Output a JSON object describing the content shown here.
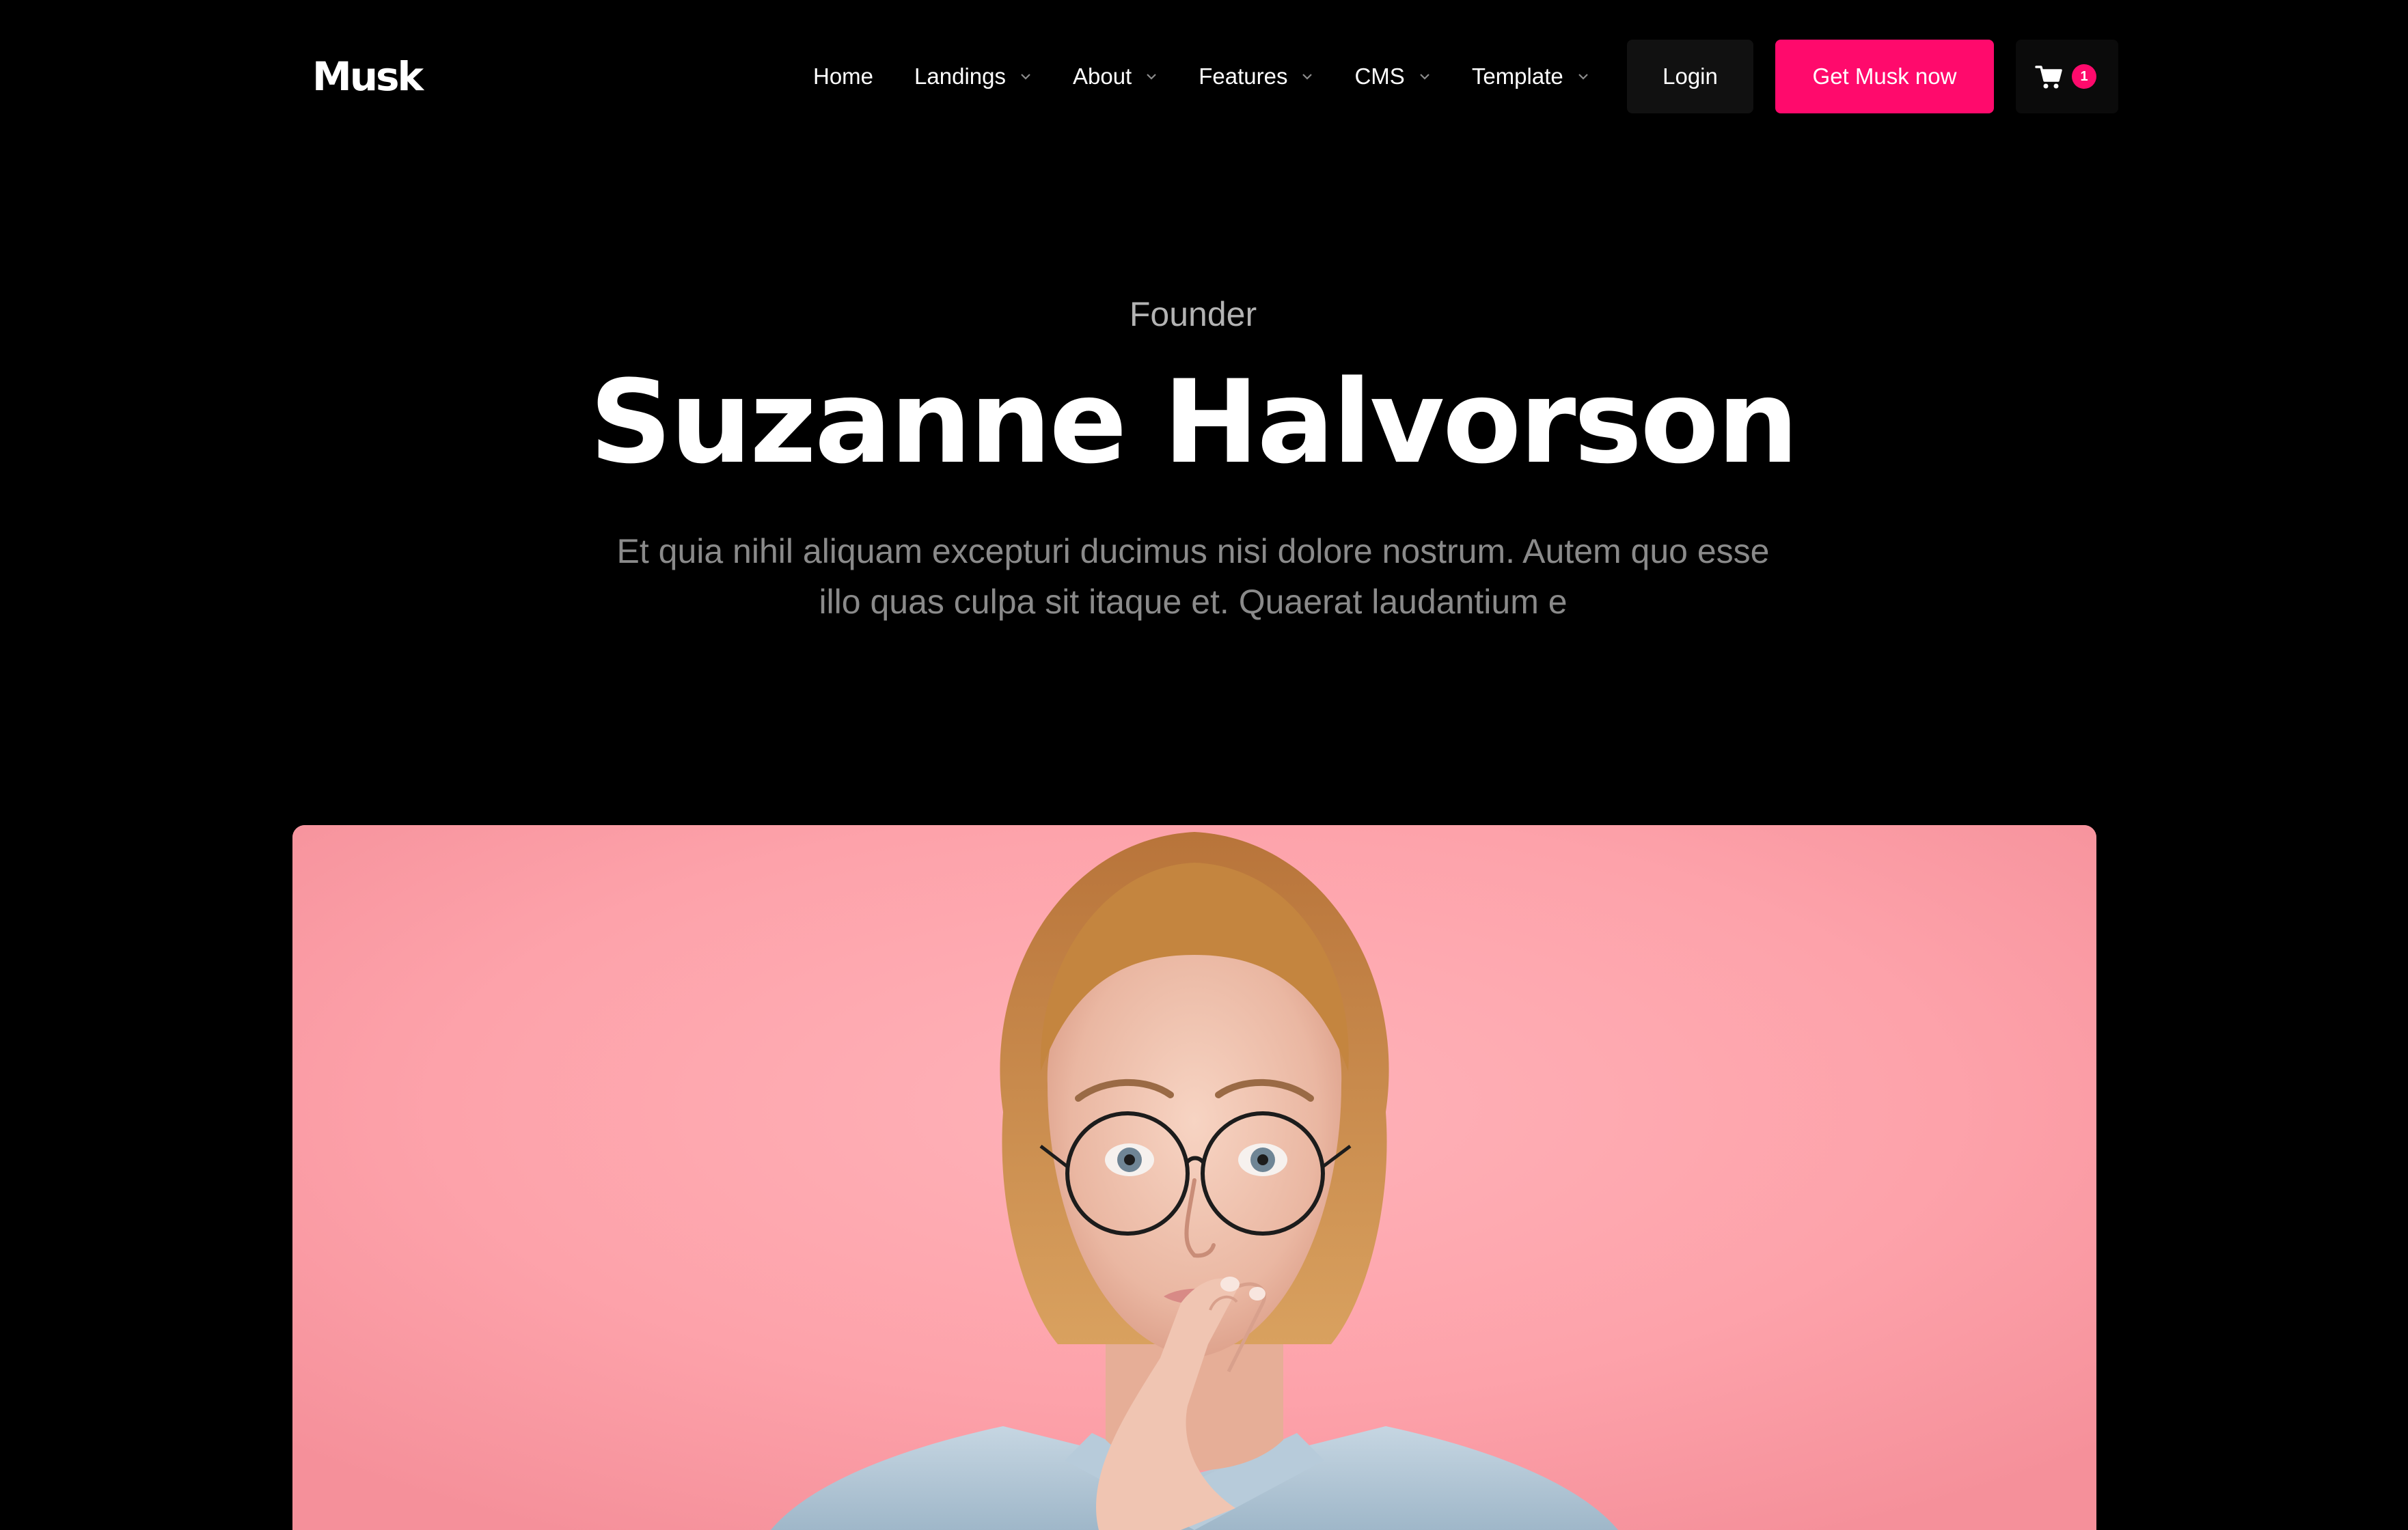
{
  "brand": {
    "logo_text": "Musk",
    "accent_color": "#ff0a6c"
  },
  "nav": {
    "items": [
      {
        "label": "Home",
        "has_dropdown": false
      },
      {
        "label": "Landings",
        "has_dropdown": true
      },
      {
        "label": "About",
        "has_dropdown": true
      },
      {
        "label": "Features",
        "has_dropdown": true
      },
      {
        "label": "CMS",
        "has_dropdown": true
      },
      {
        "label": "Template",
        "has_dropdown": true
      }
    ],
    "login_label": "Login",
    "cta_label": "Get Musk now",
    "cart_icon": "cart-icon",
    "cart_count": "1"
  },
  "hero": {
    "role": "Founder",
    "name": "Suzanne Halvorson",
    "description": "Et quia nihil aliquam excepturi ducimus nisi dolore nostrum. Autem quo esse illo quas culpa sit itaque et. Quaerat laudantium e"
  },
  "photo": {
    "background_color": "#fda3ab"
  }
}
